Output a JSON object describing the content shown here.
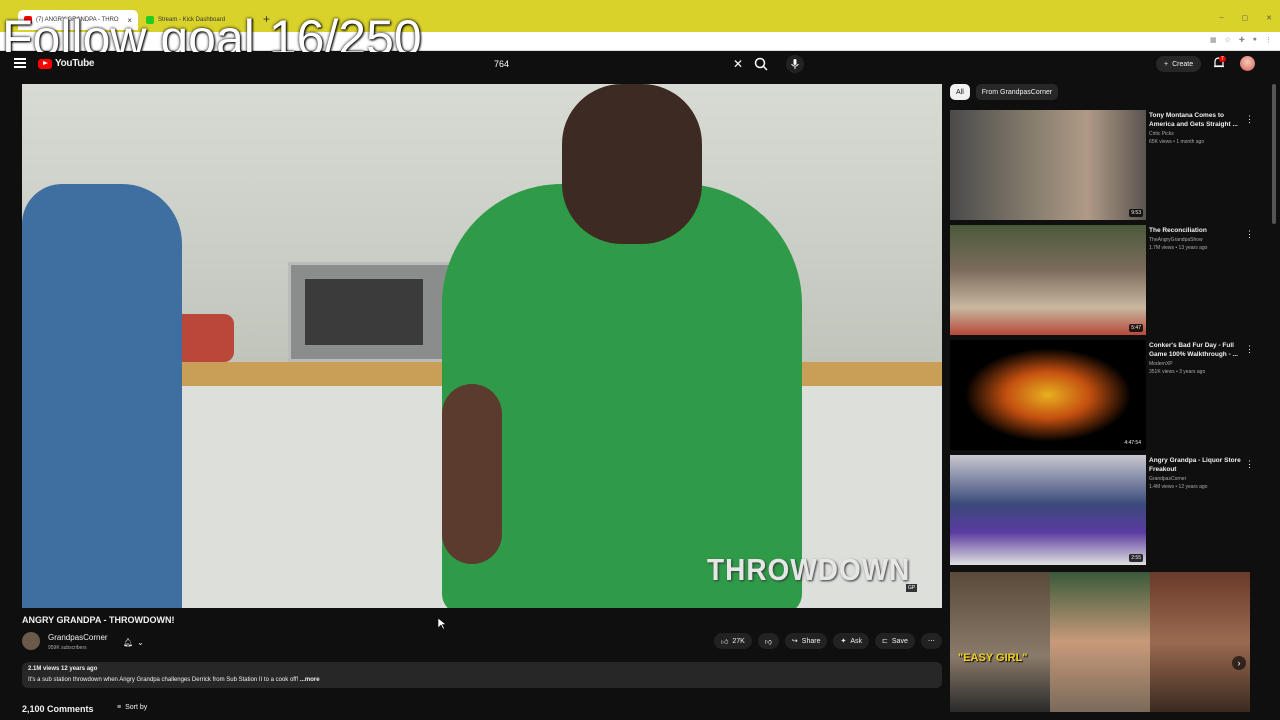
{
  "browser": {
    "tabs": [
      {
        "label": "(7) ANGRY GRANDPA - THRO",
        "active": true
      },
      {
        "label": "Stream - Kick Dashboard",
        "active": false
      }
    ]
  },
  "overlay": {
    "follow_goal": "Follow goal 16/250"
  },
  "header": {
    "logo": "YouTube",
    "search_value": "764",
    "create_label": "Create",
    "notification_count": "7"
  },
  "video": {
    "watermark": "THROWDOWN",
    "title": "ANGRY GRANDPA - THROWDOWN!",
    "channel": "GrandpasCorner",
    "subscribers": "959K subscribers",
    "likes": "27K",
    "share_label": "Share",
    "ask_label": "Ask",
    "save_label": "Save",
    "stats": "2.1M views  12 years ago",
    "description": "It's a sub station throwdown when Angry Grandpa challenges Derrick from Sub Station II to a cook off! ",
    "more_label": "...more",
    "comments_count": "2,100 Comments",
    "sort_label": "Sort by"
  },
  "sidebar": {
    "chips": [
      "All",
      "From GrandpasCorner"
    ],
    "recommendations": [
      {
        "title": "Tony Montana Comes to America and Gets Straight ...",
        "channel": "Critic Picks",
        "meta": "65K views • 1 month ago",
        "duration": "9:53",
        "thumb_color": "#6a6e72"
      },
      {
        "title": "The Reconciliation",
        "channel": "TheAngryGrandpaShow",
        "meta": "1.7M views • 13 years ago",
        "duration": "5:47",
        "thumb_color": "#7b6a5a"
      },
      {
        "title": "Conker's Bad Fur Day - Full Game 100% Walkthrough - ...",
        "channel": "ModernXP",
        "meta": "351K views • 3 years ago",
        "duration": "4:47:54",
        "thumb_color": "#000000"
      },
      {
        "title": "Angry Grandpa - Liquor Store Freakout",
        "channel": "GrandpasCorner",
        "meta": "1.4M views • 12 years ago",
        "duration": "2:55",
        "thumb_color": "#2a3a6a"
      }
    ],
    "shorts_caption": "\"EASY GIRL\""
  }
}
